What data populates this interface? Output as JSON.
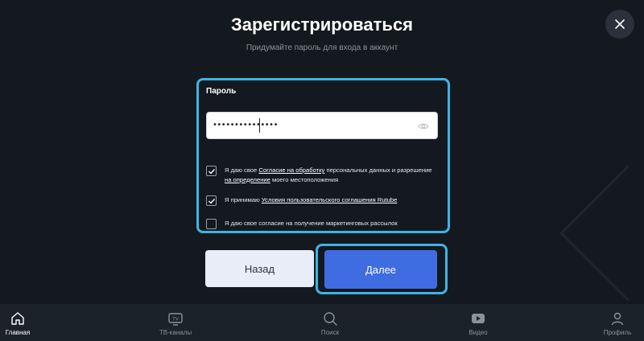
{
  "dialog": {
    "title": "Зарегистрироваться",
    "subtitle": "Придумайте пароль для входа в аккаунт"
  },
  "form": {
    "password_label": "Пароль",
    "password_value": "•••••••••••••••",
    "checkbox_1": {
      "checked": true,
      "text_before": "Я даю свое ",
      "link_1": "Согласие на обработку",
      "text_middle": " персональных данных и разрешение ",
      "link_2": "на определение",
      "text_after": " моего местоположения"
    },
    "checkbox_2": {
      "checked": true,
      "text_before": "Я принимаю ",
      "link": "Условия пользовательского соглашения Rutube"
    },
    "checkbox_3": {
      "checked": false,
      "text": "Я даю свое согласие на получение маркетинговых рассылок"
    }
  },
  "buttons": {
    "back": "Назад",
    "next": "Далее"
  },
  "nav": {
    "items": [
      {
        "label": "Главная",
        "icon": "home-icon",
        "active": true
      },
      {
        "label": "ТВ-каналы",
        "icon": "tv-icon",
        "active": false
      },
      {
        "label": "Поиск",
        "icon": "search-icon",
        "active": false
      },
      {
        "label": "Видео",
        "icon": "video-icon",
        "active": false
      },
      {
        "label": "Профиль",
        "icon": "profile-icon",
        "active": false
      }
    ]
  },
  "colors": {
    "background": "#14191f",
    "highlight": "#3db4e6",
    "primary_button": "#3f6ce1",
    "secondary_button": "#e8edf8"
  }
}
